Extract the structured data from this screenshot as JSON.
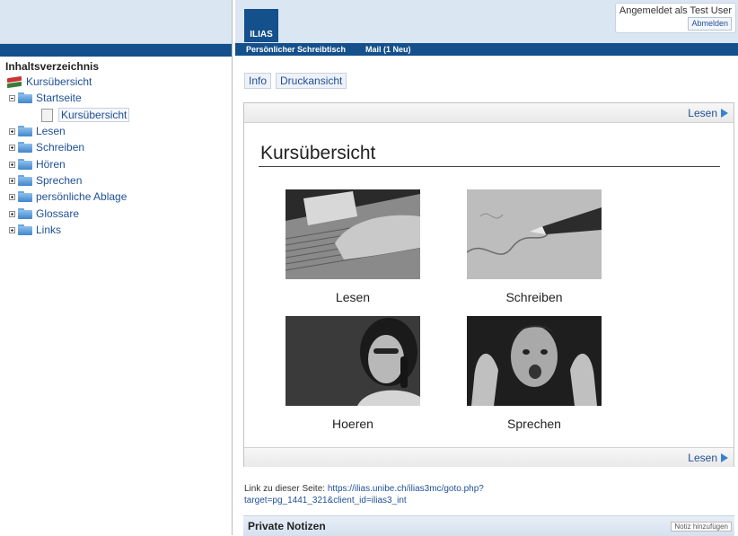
{
  "left_frame": {
    "toc_title": "Inhaltsverzeichnis",
    "items": [
      {
        "label": "Kursübersicht"
      },
      {
        "label": "Startseite"
      },
      {
        "label": "Kursübersicht"
      },
      {
        "label": "Lesen"
      },
      {
        "label": "Schreiben"
      },
      {
        "label": "Hören"
      },
      {
        "label": "Sprechen"
      },
      {
        "label": "persönliche Ablage"
      },
      {
        "label": "Glossare"
      },
      {
        "label": "Links"
      }
    ]
  },
  "header": {
    "logo_text": "ILIAS",
    "logged_in_as": "Angemeldet als Test User",
    "logout_label": "Abmelden",
    "menu": [
      "Persönlicher Schreibtisch",
      "Mail (1 Neu)"
    ]
  },
  "tabs": [
    "Info",
    "Druckansicht"
  ],
  "content": {
    "nav_next_label": "Lesen",
    "page_title": "Kursübersicht",
    "tiles": [
      {
        "caption": "Lesen"
      },
      {
        "caption": "Schreiben"
      },
      {
        "caption": "Hoeren"
      },
      {
        "caption": "Sprechen"
      }
    ]
  },
  "link_section": {
    "prefix": "Link zu dieser Seite: ",
    "url": "https://ilias.unibe.ch/ilias3mc/goto.php?target=pg_1441_321&client_id=ilias3_int"
  },
  "notes": {
    "title": "Private Notizen",
    "add_label": "Notiz hinzufügen"
  },
  "colors": {
    "brand_blue": "#14508c",
    "header_bg": "#dbe6f3",
    "link_blue": "#1f4f96"
  }
}
